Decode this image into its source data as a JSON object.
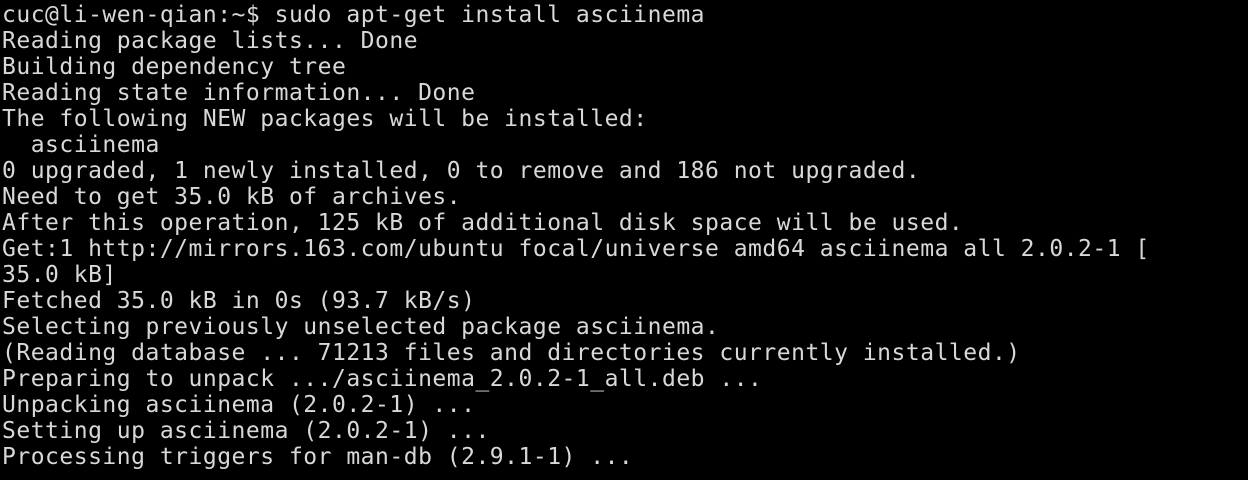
{
  "terminal": {
    "prompt": "cuc@li-wen-qian:~$ ",
    "command": "sudo apt-get install asciinema",
    "output": [
      "Reading package lists... Done",
      "Building dependency tree",
      "Reading state information... Done",
      "The following NEW packages will be installed:",
      "  asciinema",
      "0 upgraded, 1 newly installed, 0 to remove and 186 not upgraded.",
      "Need to get 35.0 kB of archives.",
      "After this operation, 125 kB of additional disk space will be used.",
      "Get:1 http://mirrors.163.com/ubuntu focal/universe amd64 asciinema all 2.0.2-1 [",
      "35.0 kB]",
      "Fetched 35.0 kB in 0s (93.7 kB/s)",
      "Selecting previously unselected package asciinema.",
      "(Reading database ... 71213 files and directories currently installed.)",
      "Preparing to unpack .../asciinema_2.0.2-1_all.deb ...",
      "Unpacking asciinema (2.0.2-1) ...",
      "Setting up asciinema (2.0.2-1) ...",
      "Processing triggers for man-db (2.9.1-1) ..."
    ]
  }
}
